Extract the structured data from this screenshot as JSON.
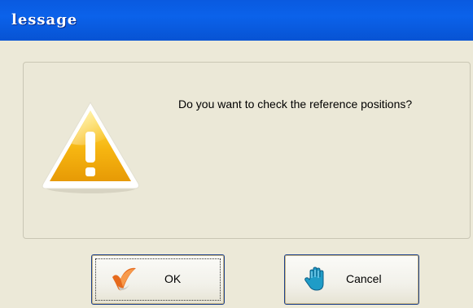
{
  "dialog": {
    "title": "lessage",
    "message": "Do you want to check the reference positions?",
    "icon": "warning-icon"
  },
  "buttons": {
    "ok_label": "OK",
    "ok_icon": "checkmark-icon",
    "cancel_label": "Cancel",
    "cancel_icon": "hand-stop-icon"
  },
  "colors": {
    "titlebar": "#0b5fe6",
    "background": "#ece9d8",
    "warning_fill": "#f2b612",
    "button_border": "#1b3f8b"
  }
}
